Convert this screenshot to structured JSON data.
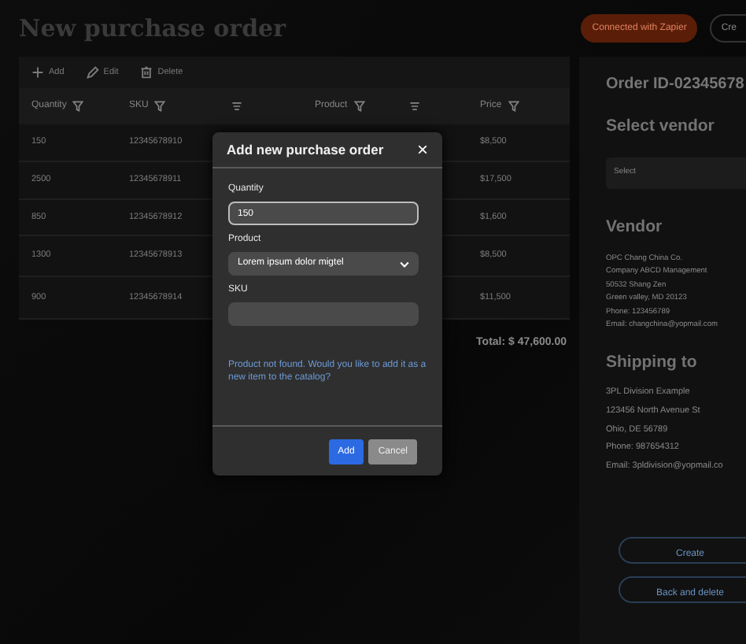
{
  "page_title": "New purchase order",
  "header_buttons": [
    {
      "label": "Connected with Zapier",
      "kind": "zapier"
    },
    {
      "label": "Cre",
      "kind": "outline"
    }
  ],
  "toolbar": [
    {
      "label": "Add",
      "kind": "add"
    },
    {
      "label": "Edit",
      "kind": "edit"
    },
    {
      "label": "Delete",
      "kind": "delete"
    }
  ],
  "table": {
    "columns": [
      {
        "label": "Quantity",
        "filter": true,
        "sort": false
      },
      {
        "label": "SKU",
        "filter": true,
        "sort": true
      },
      {
        "label": "Product",
        "filter": true,
        "sort": true
      },
      {
        "label": "Price",
        "filter": true,
        "sort": false
      }
    ],
    "rows": [
      [
        "150",
        "12345678910",
        "$8,500"
      ],
      [
        "2500",
        "12345678911",
        "$17,500"
      ],
      [
        "850",
        "12345678912",
        "$1,600"
      ],
      [
        "1300",
        "12345678913",
        "$8,500"
      ],
      [
        "900",
        "12345678914",
        "$11,500"
      ]
    ],
    "total": "Total: $ 47,600.00"
  },
  "order_panel": {
    "order_id": "Order ID-02345678",
    "vendor_heading": "Select vendor",
    "vendor_select": {
      "placeholder": "Select"
    },
    "vendor_title": "Vendor",
    "vendor_lines": [
      "OPC Chang China Co.",
      "Company ABCD Management",
      "50532 Shang Zen",
      "Green valley, MD 20123",
      "Phone: 123456789",
      "Email: changchina@yopmail.com"
    ],
    "shipping_title": "Shipping to",
    "shipping_lines": [
      "3PL Division Example",
      "123456 North Avenue St",
      "Ohio, DE 56789",
      "Phone: 987654312",
      "Email: 3pldivision@yopmail.co"
    ],
    "buttons": [
      "Create",
      "Back and delete"
    ]
  },
  "modal": {
    "title": "Add new purchase order",
    "close": "×",
    "fields": [
      {
        "label": "Quantity",
        "kind": "input",
        "value": "150",
        "focused": true
      },
      {
        "label": "Product",
        "kind": "select",
        "value": "Lorem ipsum dolor migtel",
        "focused": false
      },
      {
        "label": "SKU",
        "kind": "input",
        "focused": false
      }
    ],
    "message": "Product not found. Would you like to add it as a new item to the catalog?",
    "buttons": [
      {
        "label": "Add",
        "kind": "primary"
      },
      {
        "label": "Cancel",
        "kind": "secondary"
      }
    ]
  }
}
